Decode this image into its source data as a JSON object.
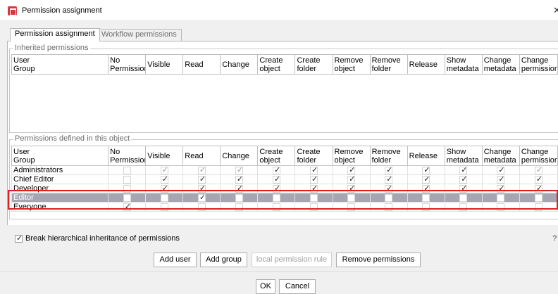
{
  "window": {
    "title": "Permission assignment",
    "close_glyph": "✕"
  },
  "tabs": [
    {
      "label": "Permission assignment",
      "active": true
    },
    {
      "label": "Workflow permissions",
      "active": false
    }
  ],
  "columns": [
    {
      "line1": "User",
      "line2": "Group"
    },
    {
      "line1": "No",
      "line2": "Permission"
    },
    {
      "line1": "Visible",
      "line2": ""
    },
    {
      "line1": "Read",
      "line2": ""
    },
    {
      "line1": "Change",
      "line2": ""
    },
    {
      "line1": "Create",
      "line2": "object"
    },
    {
      "line1": "Create",
      "line2": "folder"
    },
    {
      "line1": "Remove",
      "line2": "object"
    },
    {
      "line1": "Remove",
      "line2": "folder"
    },
    {
      "line1": "Release",
      "line2": ""
    },
    {
      "line1": "Show",
      "line2": "metadata"
    },
    {
      "line1": "Change",
      "line2": "metadata"
    },
    {
      "line1": "Change",
      "line2": "permissions"
    }
  ],
  "inherited": {
    "legend": "Inherited permissions",
    "rows": []
  },
  "defined": {
    "legend": "Permissions defined in this object",
    "rows": [
      {
        "name": "Administrators",
        "values": [
          0,
          1,
          1,
          1,
          1,
          1,
          1,
          1,
          1,
          1,
          1,
          1
        ],
        "dim": [
          0,
          1,
          1,
          1,
          0,
          0,
          0,
          0,
          0,
          0,
          0,
          1
        ]
      },
      {
        "name": "Chief Editor",
        "values": [
          0,
          1,
          1,
          1,
          1,
          1,
          1,
          1,
          1,
          1,
          1,
          1
        ],
        "dim": [
          0,
          0,
          0,
          0,
          0,
          0,
          0,
          0,
          0,
          0,
          0,
          0
        ]
      },
      {
        "name": "Developer",
        "values": [
          0,
          1,
          1,
          1,
          1,
          1,
          1,
          1,
          1,
          1,
          1,
          1
        ],
        "dim": [
          0,
          0,
          0,
          0,
          0,
          0,
          0,
          0,
          0,
          0,
          0,
          0
        ]
      },
      {
        "name": "Editor",
        "values": [
          0,
          0,
          1,
          0,
          0,
          0,
          0,
          0,
          0,
          0,
          0,
          0
        ],
        "dim": [
          0,
          0,
          0,
          0,
          0,
          0,
          0,
          0,
          0,
          0,
          0,
          0
        ],
        "selected": true
      },
      {
        "name": "Everyone",
        "values": [
          1,
          0,
          0,
          0,
          0,
          0,
          0,
          0,
          0,
          0,
          0,
          0
        ],
        "dim": [
          0,
          0,
          0,
          0,
          0,
          0,
          0,
          0,
          0,
          0,
          0,
          0
        ]
      }
    ]
  },
  "break_inheritance": {
    "label": "Break hierarchical inheritance of permissions",
    "checked": true,
    "help": "?"
  },
  "actions": {
    "add_user": "Add user",
    "add_group": "Add group",
    "local_rule": "local permission rule",
    "remove": "Remove permissions"
  },
  "footer": {
    "ok": "OK",
    "cancel": "Cancel"
  },
  "colors": {
    "highlight": "#e02020",
    "selected_row": "#a6a6b3",
    "app_icon": "#d9363e"
  }
}
